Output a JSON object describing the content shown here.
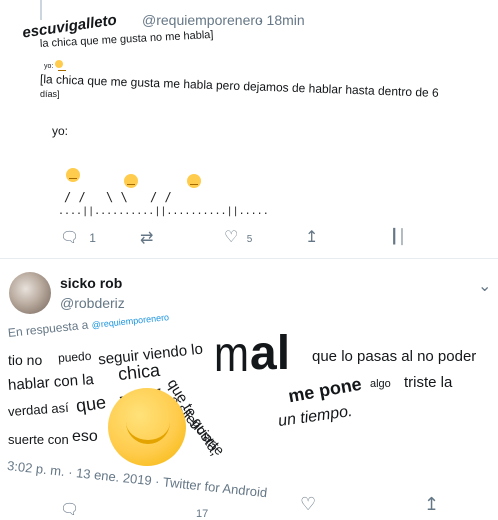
{
  "tweet1": {
    "author_name": "escuvigalleto",
    "handle": "@requiemporenero",
    "time": "· 18min",
    "quoted_line": "la chica que me gusta no me habla]",
    "small_text": "yo:",
    "body_line1": "[la chica que me gusta me habla pero dejamos de hablar hasta dentro de 6",
    "body_line2": "días]",
    "yo_label": "yo:",
    "legs": [
      "/ /",
      "\\ \\",
      "/ /"
    ],
    "ground": "....||..........||..........||.....",
    "actions": {
      "replies": "1",
      "retweets": "",
      "likes": "5"
    }
  },
  "tweet2": {
    "author_name": "sicko rob",
    "handle": "@robderiz",
    "reply_prefix": "En respuesta a",
    "reply_handle": "@requiemporenero",
    "words": {
      "w1": "tio no",
      "w2": "puedo",
      "w3": "seguir viendo lo",
      "w4": "m",
      "w5": "al",
      "w6": "que lo pasas al no poder",
      "w7": "hablar con la",
      "w8": "chica",
      "w9": "que te gusta,",
      "w10": "me pone",
      "w11": "algo",
      "w12": "triste la",
      "w13": "verdad así",
      "w14": "que",
      "w15": "voy",
      "w16": "a silenciarte",
      "w17": "un tiempo.",
      "w18": "suerte con",
      "w19": "eso"
    },
    "timestamp": "3:02 p. m. · 13 ene. 2019 · Twitter for Android",
    "bottom_count": "17"
  },
  "icons": [
    "reply-icon",
    "retweet-icon",
    "like-icon",
    "share-icon",
    "analytics-icon",
    "more-icon"
  ],
  "colors": {
    "accent": "#1b95e0",
    "muted": "#657786",
    "emoji": "#ffcc4d"
  }
}
